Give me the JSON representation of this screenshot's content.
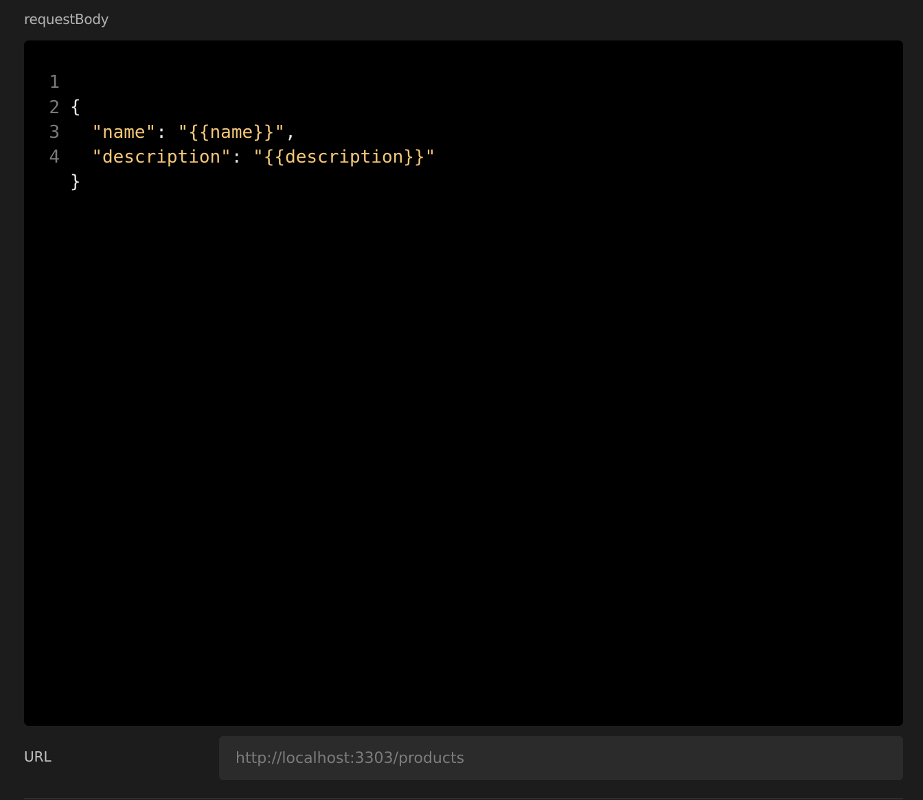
{
  "request_body": {
    "label": "requestBody",
    "lines": [
      {
        "num": "1",
        "parts": [
          {
            "t": "{",
            "c": "punc"
          }
        ]
      },
      {
        "num": "2",
        "parts": [
          {
            "t": "  ",
            "c": "punc"
          },
          {
            "t": "\"name\"",
            "c": "key"
          },
          {
            "t": ": ",
            "c": "punc"
          },
          {
            "t": "\"{{name}}\"",
            "c": "str"
          },
          {
            "t": ",",
            "c": "punc"
          }
        ]
      },
      {
        "num": "3",
        "parts": [
          {
            "t": "  ",
            "c": "punc"
          },
          {
            "t": "\"description\"",
            "c": "key"
          },
          {
            "t": ": ",
            "c": "punc"
          },
          {
            "t": "\"{{description}}\"",
            "c": "str"
          }
        ]
      },
      {
        "num": "4",
        "parts": [
          {
            "t": "}",
            "c": "punc"
          }
        ]
      }
    ]
  },
  "url_field": {
    "label": "URL",
    "placeholder": "http://localhost:3303/products",
    "value": ""
  },
  "colors": {
    "background": "#1c1c1c",
    "editor_bg": "#000000",
    "string_color": "#f3c777",
    "line_number_color": "#7a7a7a",
    "input_bg": "#2b2b2b"
  }
}
